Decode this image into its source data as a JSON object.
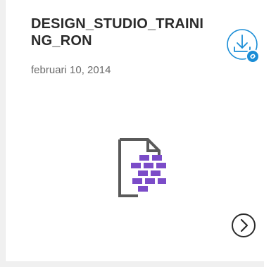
{
  "item": {
    "title": "DESIGN_STUDIO_TRAINING_RON",
    "date": "februari 10, 2014"
  },
  "icons": {
    "download": "download-link-icon",
    "document": "sharepoint-document-icon",
    "next": "chevron-right-circle-icon"
  },
  "colors": {
    "accent": "#1a8dd6",
    "doc_purple": "#7b4cc8",
    "doc_gray": "#5a5a5a"
  }
}
